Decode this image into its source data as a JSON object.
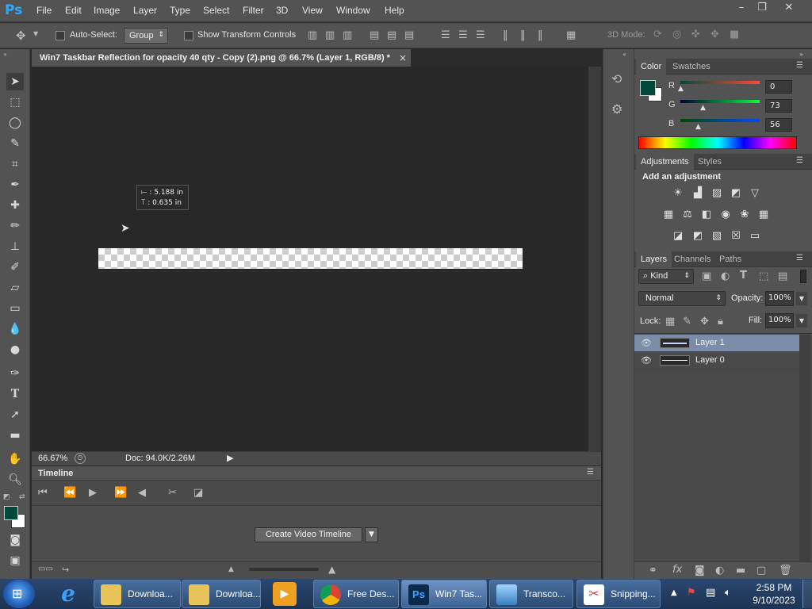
{
  "app": {
    "logo": "Ps"
  },
  "menu": [
    "File",
    "Edit",
    "Image",
    "Layer",
    "Type",
    "Select",
    "Filter",
    "3D",
    "View",
    "Window",
    "Help"
  ],
  "window_controls": {
    "minimize": "–",
    "restore": "❐",
    "close": "✕"
  },
  "options": {
    "auto_select_label": "Auto-Select:",
    "auto_select_value": "Group",
    "show_transform_label": "Show Transform Controls",
    "mode3d_label": "3D Mode:"
  },
  "document": {
    "tab_title": "Win7 Taskbar Reflection for opacity 40 qty  - Copy (2).png @ 66.7% (Layer 1, RGB/8) *",
    "tab_close": "×",
    "tooltip_x": "5.188 in",
    "tooltip_y": "0.635 in",
    "zoom": "66.67%",
    "doc_info": "Doc: 94.0K/2.26M"
  },
  "timeline": {
    "title": "Timeline",
    "create_button": "Create Video Timeline"
  },
  "color_panel": {
    "tabs": [
      "Color",
      "Swatches"
    ],
    "foreground": "#004938",
    "background": "#ffffff",
    "r_label": "R",
    "g_label": "G",
    "b_label": "B",
    "r": "0",
    "g": "73",
    "b": "56"
  },
  "adjustments_panel": {
    "tabs": [
      "Adjustments",
      "Styles"
    ],
    "heading": "Add an adjustment"
  },
  "layers_panel": {
    "tabs": [
      "Layers",
      "Channels",
      "Paths"
    ],
    "kind_label": "Kind",
    "blend_mode": "Normal",
    "opacity_label": "Opacity:",
    "opacity_value": "100%",
    "lock_label": "Lock:",
    "fill_label": "Fill:",
    "fill_value": "100%",
    "layers": [
      {
        "name": "Layer 1",
        "selected": true
      },
      {
        "name": "Layer 0",
        "selected": false
      }
    ]
  },
  "taskbar": {
    "buttons": [
      {
        "label": "Downloa..."
      },
      {
        "label": "Downloa..."
      },
      {
        "label": "Free Des..."
      },
      {
        "label": "Win7 Tas..."
      },
      {
        "label": "Transco..."
      },
      {
        "label": "Snipping..."
      }
    ],
    "time": "2:58 PM",
    "date": "9/10/2023"
  }
}
